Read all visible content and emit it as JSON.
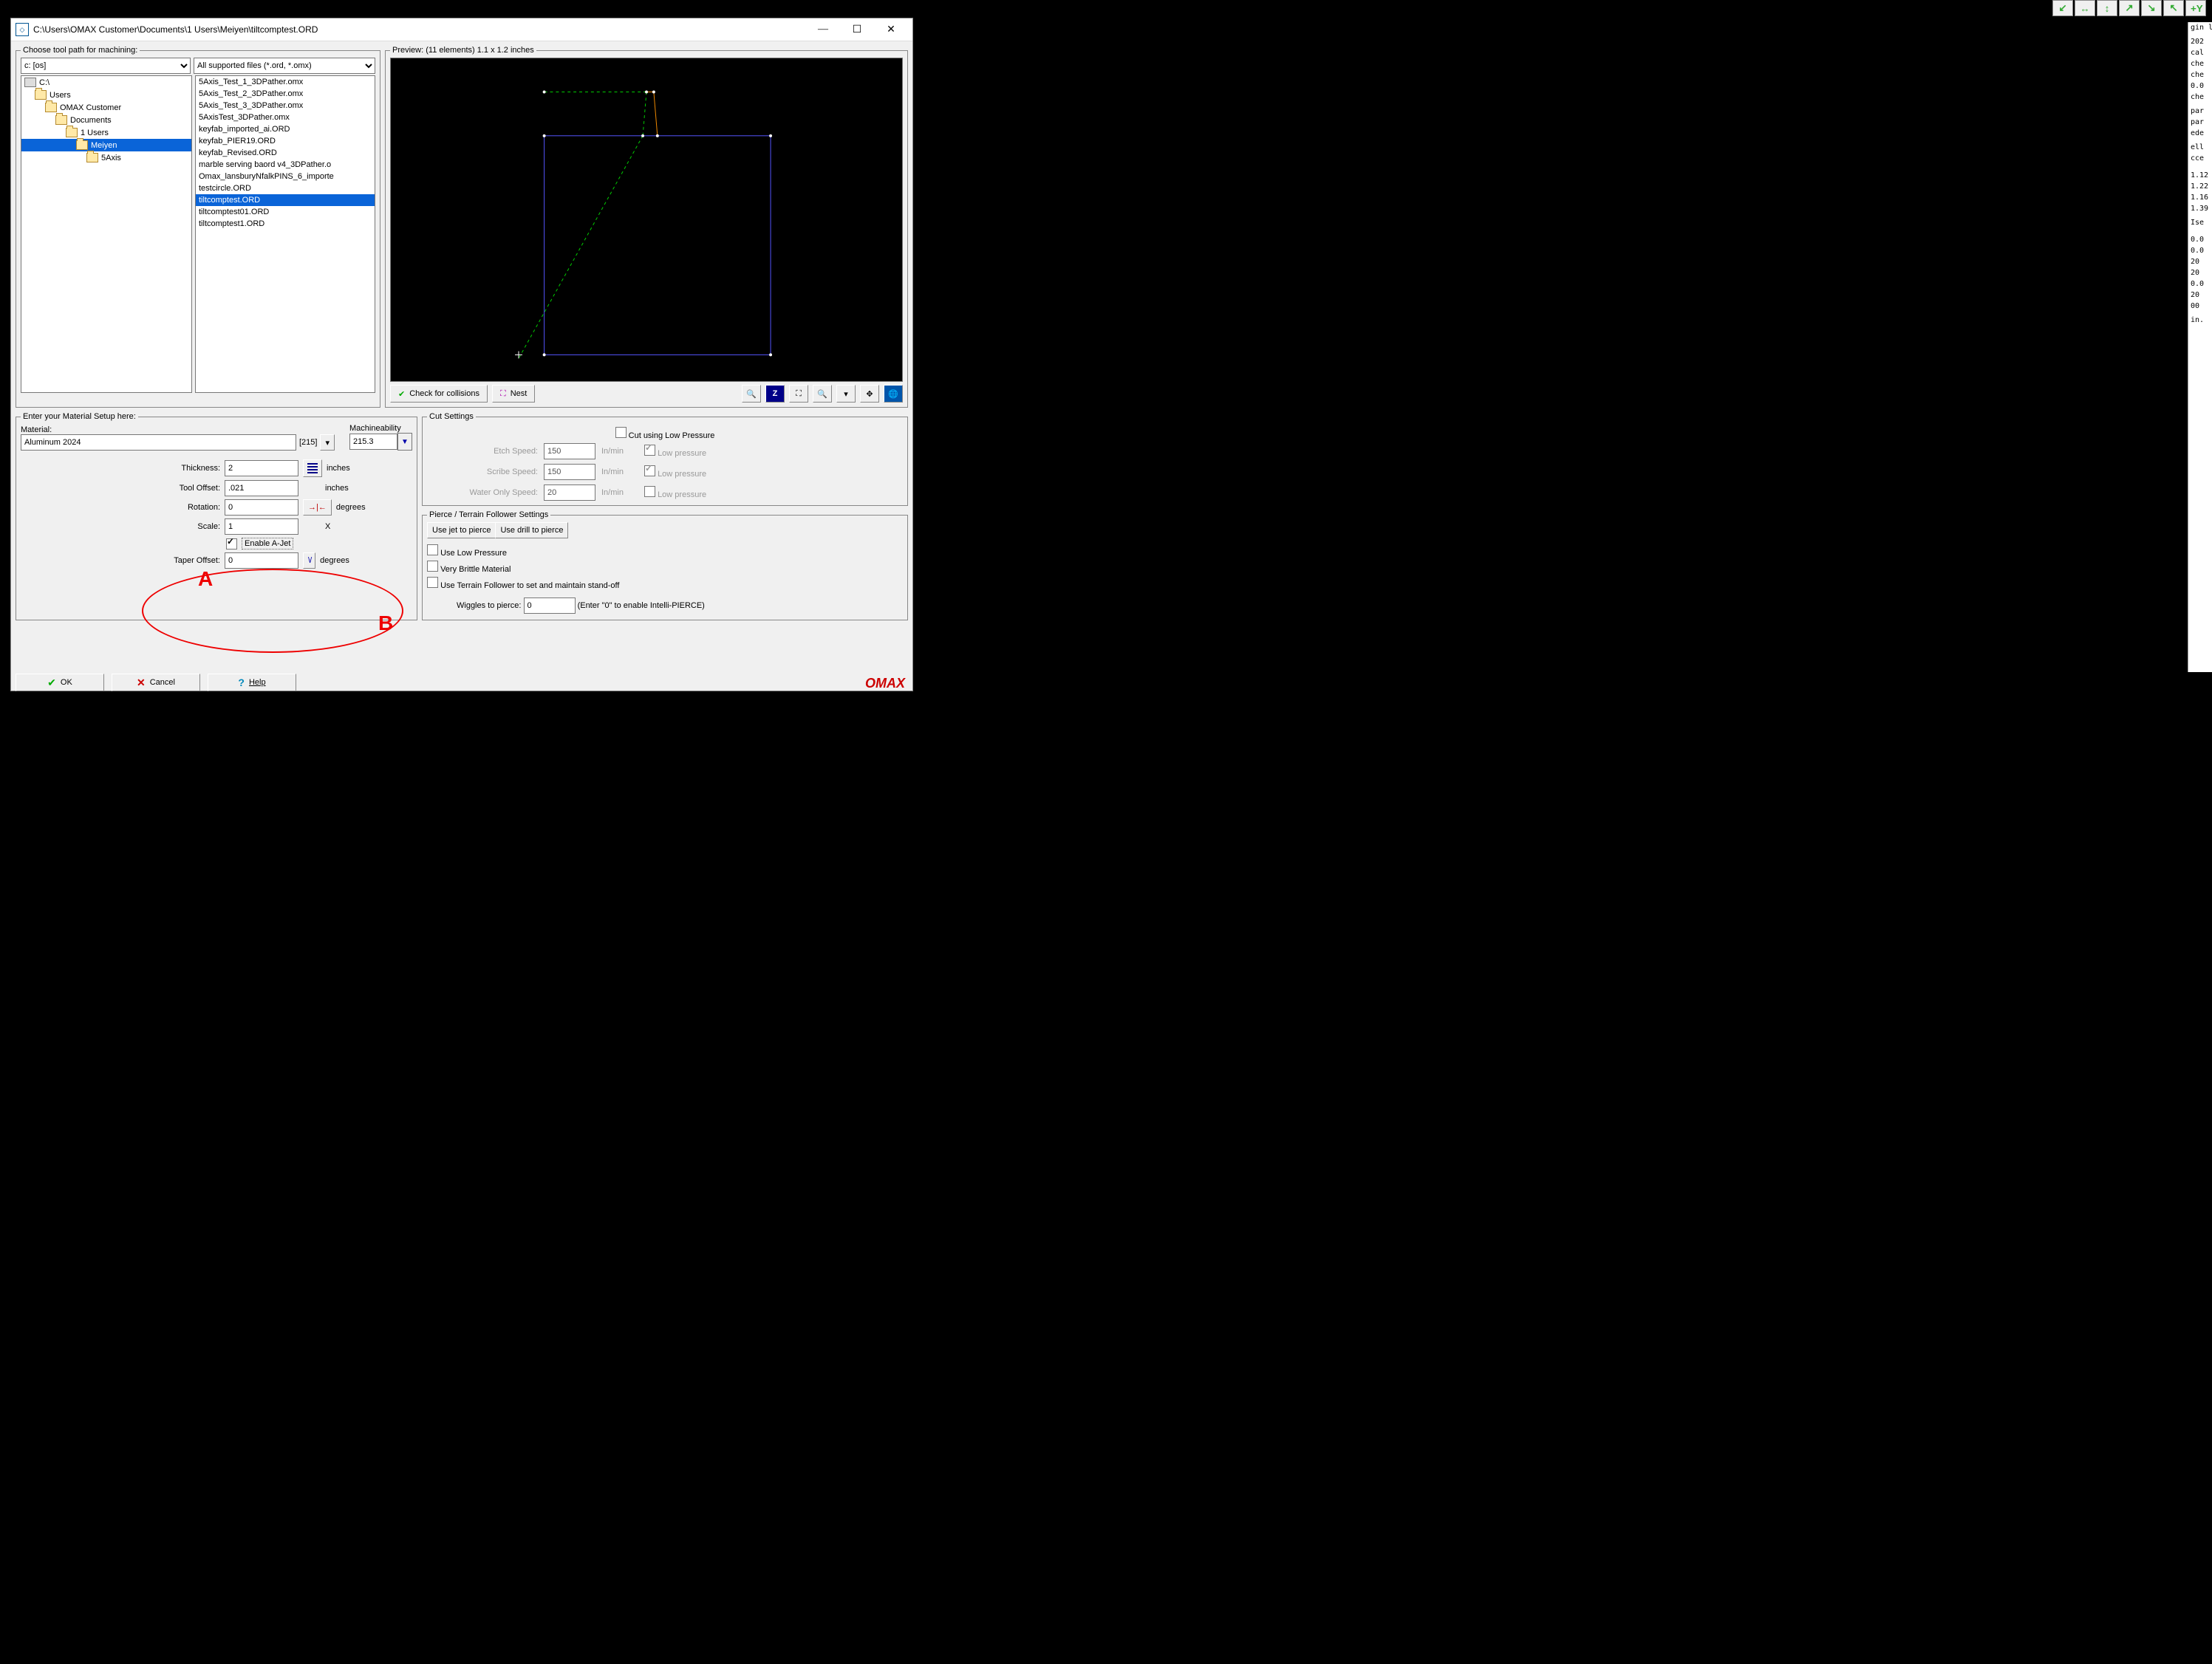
{
  "window": {
    "title": "C:\\Users\\OMAX Customer\\Documents\\1 Users\\Meiyen\\tiltcomptest.ORD"
  },
  "top_buttons": [
    "↙",
    "↔",
    "↕",
    "↗",
    "↘",
    "↖",
    "+Y"
  ],
  "right_strip": [
    "gin l",
    "",
    "202",
    "cal",
    "che",
    "che",
    "0.0",
    "che",
    "",
    "par",
    "par",
    "ede",
    "",
    "ell",
    "cce",
    "",
    "",
    "1.12",
    "1.22",
    "1.16",
    "1.39",
    "",
    "Ise",
    "",
    "",
    "0.0",
    "0.0",
    "20",
    "20",
    "0.0",
    "20",
    "00",
    "",
    "in."
  ],
  "file_group": {
    "legend": "Choose tool path for machining:",
    "drive": "c: [os]",
    "filter": "All supported files (*.ord, *.omx)"
  },
  "folders": [
    {
      "label": "C:\\",
      "depth": 0,
      "sel": false,
      "type": "drive"
    },
    {
      "label": "Users",
      "depth": 1,
      "sel": false,
      "type": "folder"
    },
    {
      "label": "OMAX Customer",
      "depth": 2,
      "sel": false,
      "type": "folder"
    },
    {
      "label": "Documents",
      "depth": 3,
      "sel": false,
      "type": "folder"
    },
    {
      "label": "1 Users",
      "depth": 4,
      "sel": false,
      "type": "folder"
    },
    {
      "label": "Meiyen",
      "depth": 5,
      "sel": true,
      "type": "folder"
    },
    {
      "label": "5Axis",
      "depth": 6,
      "sel": false,
      "type": "folder"
    }
  ],
  "files": [
    {
      "name": "5Axis_Test_1_3DPather.omx",
      "sel": false
    },
    {
      "name": "5Axis_Test_2_3DPather.omx",
      "sel": false
    },
    {
      "name": "5Axis_Test_3_3DPather.omx",
      "sel": false
    },
    {
      "name": "5AxisTest_3DPather.omx",
      "sel": false
    },
    {
      "name": "keyfab_imported_ai.ORD",
      "sel": false
    },
    {
      "name": "keyfab_PIER19.ORD",
      "sel": false
    },
    {
      "name": "keyfab_Revised.ORD",
      "sel": false
    },
    {
      "name": "marble serving baord v4_3DPather.o",
      "sel": false
    },
    {
      "name": "Omax_lansburyNfalkPINS_6_importe",
      "sel": false
    },
    {
      "name": "testcircle.ORD",
      "sel": false
    },
    {
      "name": "tiltcomptest.ORD",
      "sel": true
    },
    {
      "name": "tiltcomptest01.ORD",
      "sel": false
    },
    {
      "name": "tiltcomptest1.ORD",
      "sel": false
    }
  ],
  "preview": {
    "legend": "Preview: (11 elements) 1.1 x 1.2 inches",
    "check": "Check for collisions",
    "nest": "Nest"
  },
  "material": {
    "legend": "Enter your Material Setup here:",
    "mat_label": "Material:",
    "mat_value": "Aluminum 2024",
    "mat_code": "[215]",
    "mach_label": "Machineability",
    "mach_value": "215.3",
    "thickness_label": "Thickness:",
    "thickness": "2",
    "thickness_unit": "inches",
    "tool_label": "Tool Offset:",
    "tool": ".021",
    "tool_unit": "inches",
    "rot_label": "Rotation:",
    "rot": "0",
    "rot_unit": "degrees",
    "scale_label": "Scale:",
    "scale": "1",
    "scale_unit": "X",
    "ajet_label": "Enable A-Jet",
    "ajet": true,
    "taper_label": "Taper Offset:",
    "taper": "0",
    "taper_unit": "degrees",
    "ann_a": "A",
    "ann_b": "B"
  },
  "cut": {
    "legend": "Cut Settings",
    "low_press": "Cut using Low Pressure",
    "low_press_on": false,
    "etch_label": "Etch Speed:",
    "etch": "150",
    "etch_unit": "In/min",
    "etch_lp": "Low pressure",
    "etch_lp_on": true,
    "scribe_label": "Scribe Speed:",
    "scribe": "150",
    "scribe_unit": "In/min",
    "scribe_lp": "Low pressure",
    "scribe_lp_on": true,
    "water_label": "Water Only Speed:",
    "water": "20",
    "water_unit": "In/min",
    "water_lp": "Low pressure",
    "water_lp_on": false
  },
  "pierce": {
    "legend": "Pierce / Terrain Follower Settings",
    "jet_btn": "Use jet to pierce",
    "drill_btn": "Use drill to pierce",
    "low": "Use Low Pressure",
    "low_on": false,
    "brittle": "Very Brittle Material",
    "brittle_on": false,
    "terrain": "Use Terrain Follower to set and maintain stand-off",
    "terrain_on": false,
    "wiggle_label": "Wiggles to pierce:",
    "wiggle": "0",
    "wiggle_hint": "(Enter \"0\" to enable Intelli-PIERCE)"
  },
  "bottom": {
    "ok": "OK",
    "cancel": "Cancel",
    "help": "Help"
  },
  "brand": "OMAX"
}
